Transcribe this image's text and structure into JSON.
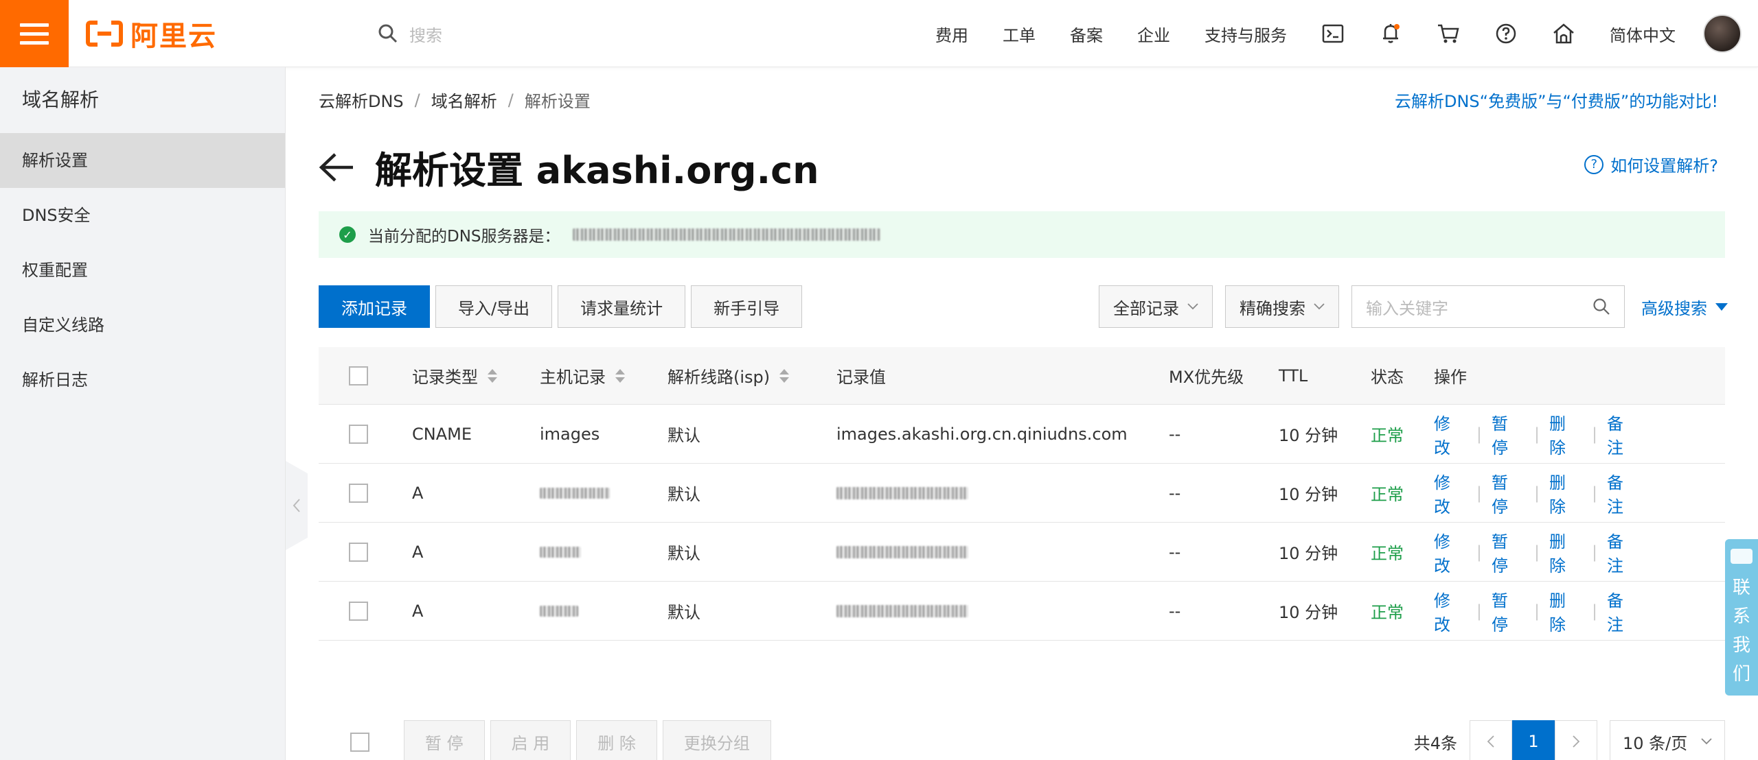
{
  "header": {
    "logo_text": "阿里云",
    "search_placeholder": "搜索",
    "nav": [
      "费用",
      "工单",
      "备案",
      "企业",
      "支持与服务"
    ],
    "language": "简体中文"
  },
  "sidebar": {
    "title": "域名解析",
    "items": [
      {
        "label": "解析设置",
        "active": true
      },
      {
        "label": "DNS安全",
        "active": false
      },
      {
        "label": "权重配置",
        "active": false
      },
      {
        "label": "自定义线路",
        "active": false
      },
      {
        "label": "解析日志",
        "active": false
      }
    ]
  },
  "breadcrumb": [
    "云解析DNS",
    "域名解析",
    "解析设置"
  ],
  "compare_link": "云解析DNS“免费版”与“付费版”的功能对比!",
  "page_title": "解析设置 akashi.org.cn",
  "help_link": "如何设置解析?",
  "notice": {
    "label": "当前分配的DNS服务器是："
  },
  "toolbar": {
    "add": "添加记录",
    "import_export": "导入/导出",
    "stats": "请求量统计",
    "guide": "新手引导"
  },
  "filters": {
    "all_records": "全部记录",
    "exact_search": "精确搜索",
    "keyword_placeholder": "输入关键字",
    "advanced": "高级搜索"
  },
  "table": {
    "columns": [
      "记录类型",
      "主机记录",
      "解析线路(isp)",
      "记录值",
      "MX优先级",
      "TTL",
      "状态",
      "操作"
    ],
    "ops": [
      "修改",
      "暂停",
      "删除",
      "备注"
    ],
    "rows": [
      {
        "type": "CNAME",
        "host": "images",
        "line": "默认",
        "value": "images.akashi.org.cn.qiniudns.com",
        "mx": "--",
        "ttl": "10 分钟",
        "status": "正常"
      },
      {
        "type": "A",
        "host": "",
        "line": "默认",
        "value": "",
        "mx": "--",
        "ttl": "10 分钟",
        "status": "正常"
      },
      {
        "type": "A",
        "host": "",
        "line": "默认",
        "value": "",
        "mx": "--",
        "ttl": "10 分钟",
        "status": "正常"
      },
      {
        "type": "A",
        "host": "",
        "line": "默认",
        "value": "",
        "mx": "--",
        "ttl": "10 分钟",
        "status": "正常"
      }
    ]
  },
  "bulk": {
    "pause": "暂 停",
    "enable": "启 用",
    "delete": "删 除",
    "change_group": "更换分组"
  },
  "pagination": {
    "total": "共4条",
    "current_page": "1",
    "page_size": "10 条/页"
  },
  "contact": [
    "联",
    "系",
    "我",
    "们"
  ],
  "colors": {
    "brand": "#ff6a00",
    "link": "#0070cc",
    "success": "#1e9e4a",
    "notice_bg": "#ecfbf1",
    "contact_bg": "#79c8e6"
  }
}
